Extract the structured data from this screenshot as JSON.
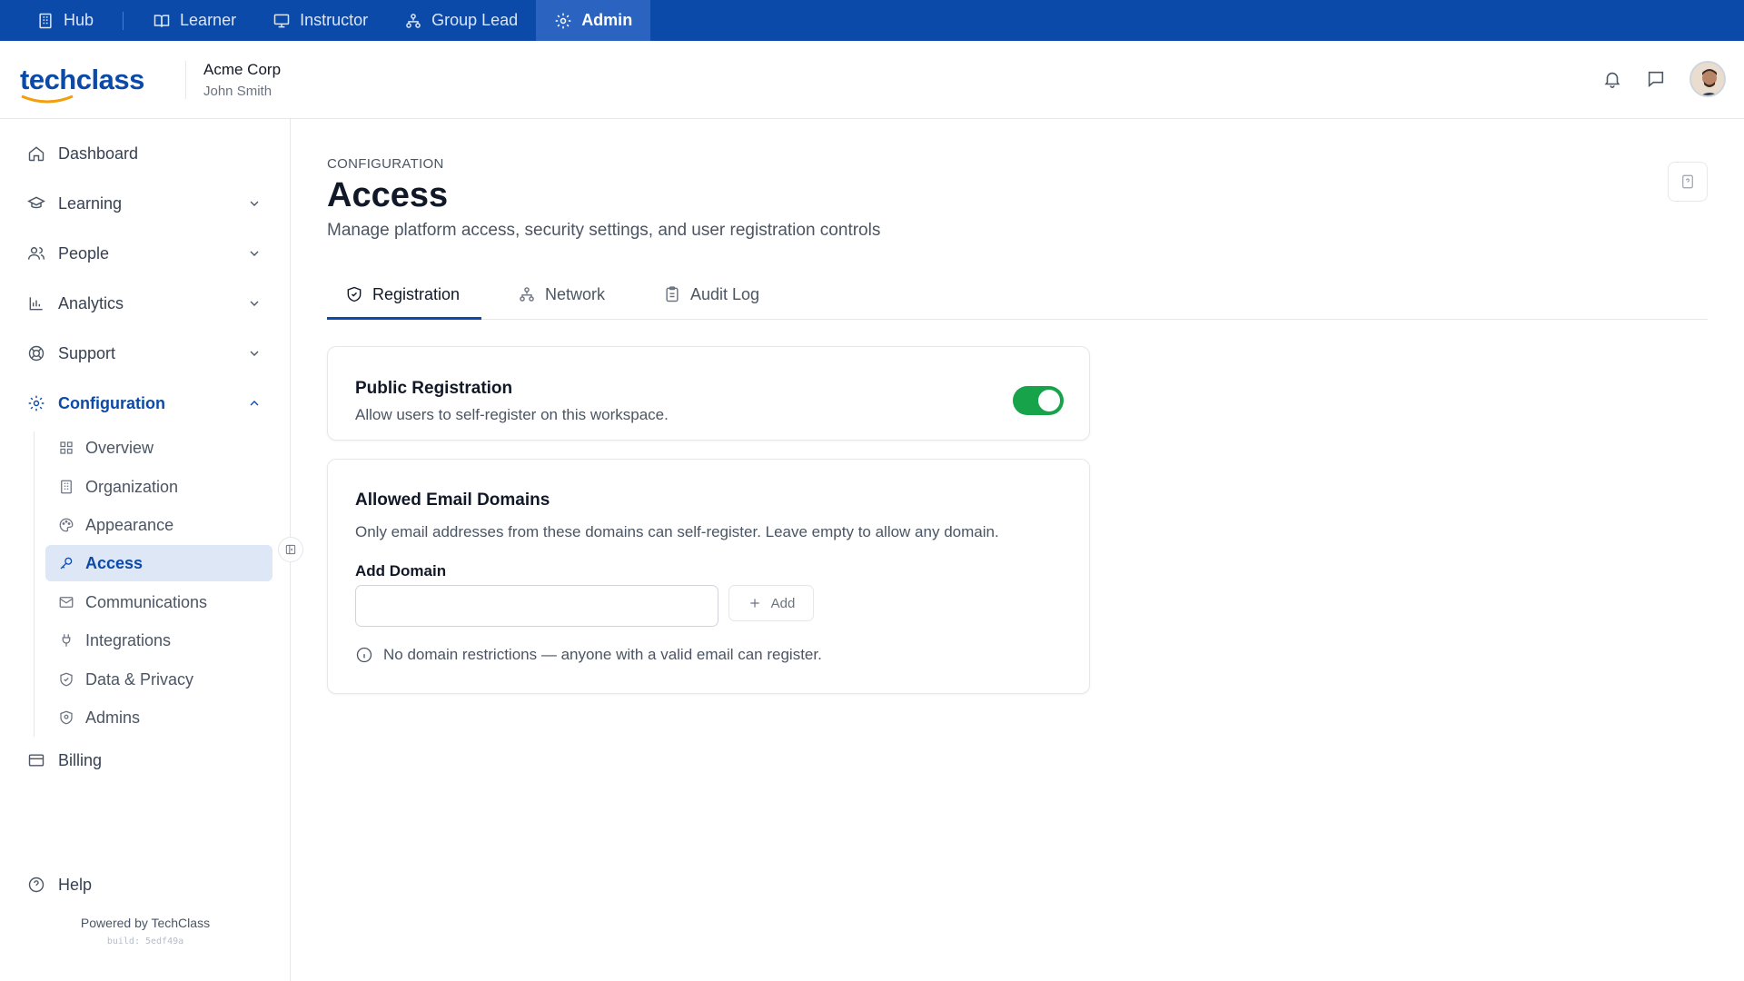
{
  "roles": [
    {
      "label": "Hub",
      "icon": "building-icon"
    },
    {
      "label": "Learner",
      "icon": "book-open-icon"
    },
    {
      "label": "Instructor",
      "icon": "presentation-icon"
    },
    {
      "label": "Group Lead",
      "icon": "network-icon"
    },
    {
      "label": "Admin",
      "icon": "gear-icon",
      "active": true
    }
  ],
  "header": {
    "logo_text": "techclass",
    "org_name": "Acme Corp",
    "user_name": "John Smith"
  },
  "sidebar": {
    "items": [
      {
        "label": "Dashboard",
        "icon": "home-icon"
      },
      {
        "label": "Learning",
        "icon": "graduation-cap-icon"
      },
      {
        "label": "People",
        "icon": "users-icon"
      },
      {
        "label": "Analytics",
        "icon": "bar-chart-icon"
      },
      {
        "label": "Support",
        "icon": "lifebuoy-icon"
      },
      {
        "label": "Configuration",
        "icon": "gear-icon",
        "expanded": true
      }
    ],
    "sub_items": [
      {
        "label": "Overview",
        "icon": "grid-icon"
      },
      {
        "label": "Organization",
        "icon": "building-icon"
      },
      {
        "label": "Appearance",
        "icon": "palette-icon"
      },
      {
        "label": "Access",
        "icon": "key-icon",
        "active": true
      },
      {
        "label": "Communications",
        "icon": "mail-icon"
      },
      {
        "label": "Integrations",
        "icon": "plug-icon"
      },
      {
        "label": "Data & Privacy",
        "icon": "shield-icon"
      },
      {
        "label": "Admins",
        "icon": "admin-shield-icon"
      }
    ],
    "billing": "Billing",
    "help": "Help",
    "powered_by": "Powered by TechClass",
    "build": "build: 5edf49a"
  },
  "page": {
    "eyebrow": "CONFIGURATION",
    "title": "Access",
    "description": "Manage platform access, security settings, and user registration controls"
  },
  "tabs": [
    {
      "label": "Registration",
      "icon": "shield-check-icon",
      "active": true
    },
    {
      "label": "Network",
      "icon": "network-icon"
    },
    {
      "label": "Audit Log",
      "icon": "clipboard-icon"
    }
  ],
  "public_registration": {
    "title": "Public Registration",
    "description": "Allow users to self-register on this workspace.",
    "enabled": true
  },
  "email_domains": {
    "title": "Allowed Email Domains",
    "description": "Only email addresses from these domains can self-register. Leave empty to allow any domain.",
    "field_label": "Add Domain",
    "input_value": "",
    "add_label": "Add",
    "empty_notice": "No domain restrictions — anyone with a valid email can register."
  },
  "colors": {
    "brand": "#0b4aa8",
    "toggle_on": "#16a34a",
    "active_bg": "#dde7f6"
  }
}
